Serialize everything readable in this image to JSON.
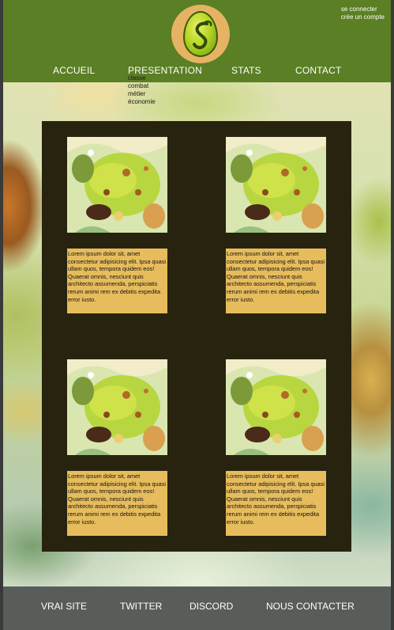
{
  "header": {
    "account_links": [
      "se connecter",
      "crée un compte"
    ],
    "nav": [
      "ACCUEIL",
      "PRESENTATION",
      "STATS",
      "CONTACT"
    ],
    "submenu": [
      "classe",
      "combat",
      "métier",
      "économie"
    ]
  },
  "cards": [
    {
      "text": "Lorem ipsum dolor sit, amet consectetur adipisicing elit. Ipsa quasi ullam quos, tempora quidem eos! Quaerat omnis, nesciunt quis architecto assumenda, perspiciatis rerum animi rem ex debitis expedita error iusto."
    },
    {
      "text": "Lorem ipsum dolor sit, amet consectetur adipisicing elit. Ipsa quasi ullam quos, tempora quidem eos! Quaerat omnis, nesciunt quis architecto assumenda, perspiciatis rerum animi rem ex debitis expedita error iusto."
    },
    {
      "text": "Lorem ipsum dolor sit, amet consectetur adipisicing elit. Ipsa quasi ullam quos, tempora quidem eos! Quaerat omnis, nesciunt quis architecto assumenda, perspiciatis rerum animi rem ex debitis expedita error iusto."
    },
    {
      "text": "Lorem ipsum dolor sit, amet consectetur adipisicing elit. Ipsa quasi ullam quos, tempora quidem eos! Quaerat omnis, nesciunt quis architecto assumenda, perspiciatis rerum animi rem ex debitis expedita error iusto."
    }
  ],
  "footer": {
    "links": [
      "VRAI SITE",
      "TWITTER",
      "DISCORD",
      "NOUS CONTACTER"
    ]
  },
  "colors": {
    "header_bg": "#5b7f24",
    "logo_bg": "#e6b365",
    "panel_bg": "#27230f",
    "card_text_bg": "#e7bc5c",
    "footer_bg": "#595d5a"
  },
  "icons": {
    "logo": "green-egg-logo-icon"
  }
}
